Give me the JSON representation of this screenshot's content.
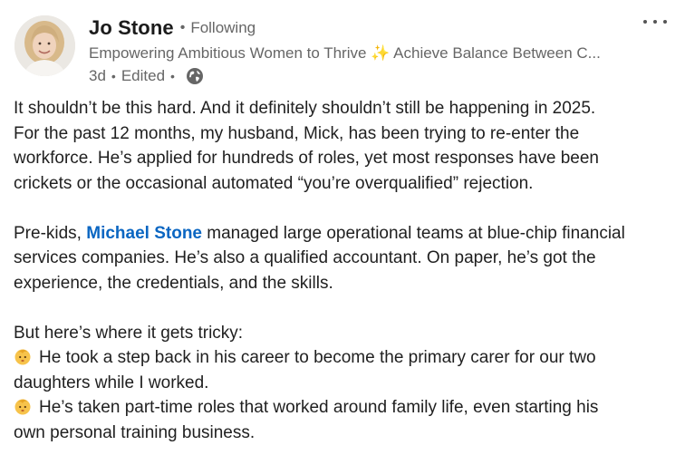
{
  "author": {
    "name": "Jo Stone",
    "separator": "•",
    "follow_status": "Following",
    "headline_part1": "Empowering Ambitious Women to Thrive",
    "headline_sparkle": "✨",
    "headline_part2": "Achieve Balance Between C...",
    "age": "3d",
    "edited": "Edited",
    "visibility_icon": "globe-icon"
  },
  "menu": {
    "icon": "more-horizontal-icon"
  },
  "post": {
    "p1": [
      "It shouldn’t be this hard. And it definitely shouldn’t still be happening in 2025.",
      "For the past 12 months, my husband, Mick, has been trying to re-enter the",
      "workforce. He’s applied for hundreds of roles, yet most responses have been",
      "crickets or the occasional automated “you’re overqualified” rejection."
    ],
    "p2_intro": "Pre-kids, ",
    "p2_mention": "Michael Stone",
    "p2_rest": " managed large operational teams at blue-chip financial",
    "p2_lines": [
      "services companies. He’s also a qualified accountant. On paper, he’s got the",
      "experience, the credentials, and the skills."
    ],
    "p3_lead": "But here’s where it gets tricky:",
    "bullet_icon": "baby-emoji-icon",
    "bullet1_line1": "He took a step back in his career to become the primary carer for our two",
    "bullet1_line2": "daughters while I worked.",
    "bullet2_line1": "He’s taken part-time roles that worked around family life, even starting his",
    "bullet2_line2": "own personal training business."
  },
  "colors": {
    "mention": "#0a66c2",
    "secondary_text": "#666666",
    "body_text": "#1f1f1f"
  }
}
